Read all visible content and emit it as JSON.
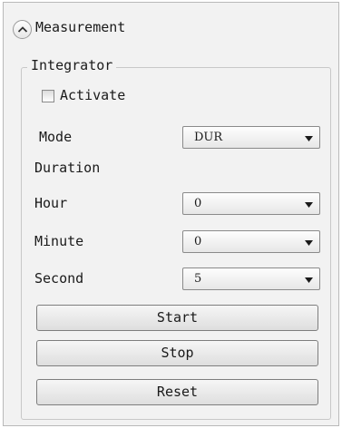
{
  "header": {
    "title": "Measurement",
    "collapse_icon": "chevron-up-icon"
  },
  "integrator": {
    "group_title": "Integrator",
    "activate": {
      "label": "Activate",
      "checked": false
    },
    "mode": {
      "label": "Mode",
      "value": "DUR"
    },
    "duration_label": "Duration",
    "hour": {
      "label": "Hour",
      "value": "0"
    },
    "minute": {
      "label": "Minute",
      "value": "0"
    },
    "second": {
      "label": "Second",
      "value": "5"
    },
    "buttons": {
      "start": "Start",
      "stop": "Stop",
      "reset": "Reset"
    }
  }
}
